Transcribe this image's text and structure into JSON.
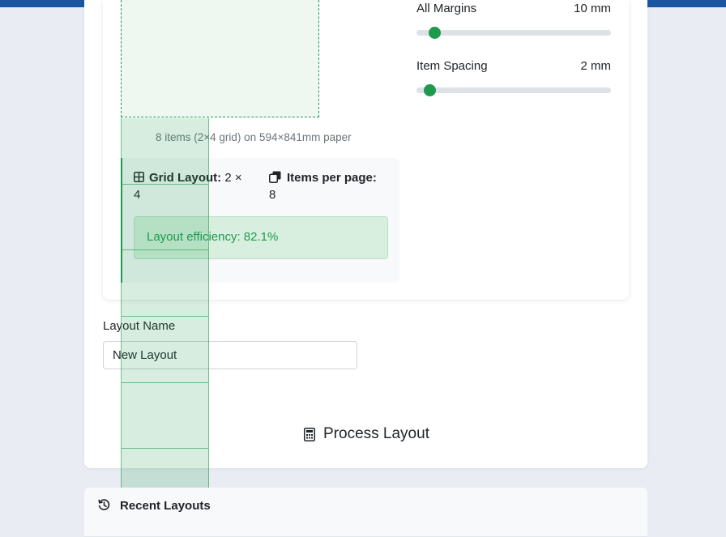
{
  "sliders": [
    {
      "label": "All Margins",
      "value": "10 mm",
      "fraction": 0.08
    },
    {
      "label": "Item Spacing",
      "value": "2 mm",
      "fraction": 0.03
    }
  ],
  "preview": {
    "summary": "8 items (2×4 grid) on 594×841mm paper"
  },
  "layout_info": {
    "grid_label": "Grid Layout:",
    "grid_value_1": "2 ×",
    "grid_value_2": "4",
    "items_label": "Items per page:",
    "items_value": "8",
    "efficiency": "Layout efficiency: 82.1%"
  },
  "layout_name": {
    "label": "Layout Name",
    "value": "New Layout"
  },
  "process_button": {
    "label": "Process Layout",
    "icon": "calculator-icon"
  },
  "recent": {
    "title": "Recent Layouts",
    "icon": "history-icon"
  },
  "colors": {
    "accent": "#1e9a4e",
    "topbar": "#1a56a0",
    "background": "#e9ecf3"
  }
}
